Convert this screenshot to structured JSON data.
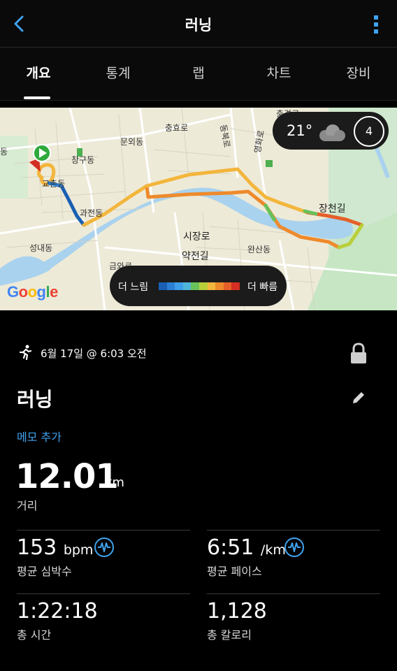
{
  "header": {
    "title": "러닝",
    "back_icon": "back-chevron-icon",
    "more_icon": "more-vertical-icon",
    "accent": "#3fa3f0"
  },
  "tabs": [
    "개요",
    "통계",
    "랩",
    "차트",
    "장비"
  ],
  "map": {
    "labels": [
      "충효로",
      "문외동",
      "창구동",
      "동",
      "교촌동",
      "과전동",
      "성내동",
      "시장로",
      "약전길",
      "금와로",
      "완산동",
      "장천길",
      "영화로",
      "동북로",
      "충경로"
    ],
    "weather": {
      "temperature": "21°",
      "icon": "cloud-icon",
      "wind": "4"
    },
    "legend": {
      "slow_label": "더 느림",
      "fast_label": "더 빠름",
      "colors": [
        "#1a5fb4",
        "#2b7fd4",
        "#3f9ee8",
        "#4fb6d8",
        "#68c15a",
        "#b9cf3a",
        "#f3b63c",
        "#ee8a2c",
        "#e56028",
        "#d42f22"
      ]
    },
    "attribution": "Google"
  },
  "activity": {
    "date": "6월 17일 @ 6:03 오전",
    "title": "러닝",
    "memo": "메모 추가"
  },
  "distance": {
    "value": "12.01",
    "unit": "km",
    "label": "거리"
  },
  "stats": [
    {
      "value": "153",
      "unit": "bpm",
      "label": "평균 심박수",
      "icon": "pulse-icon"
    },
    {
      "value": "6:51",
      "unit": "/km",
      "label": "평균 페이스",
      "icon": "pulse-icon"
    },
    {
      "value": "1:22:18",
      "unit": "",
      "label": "총 시간"
    },
    {
      "value": "1,128",
      "unit": "",
      "label": "총 칼로리"
    }
  ]
}
